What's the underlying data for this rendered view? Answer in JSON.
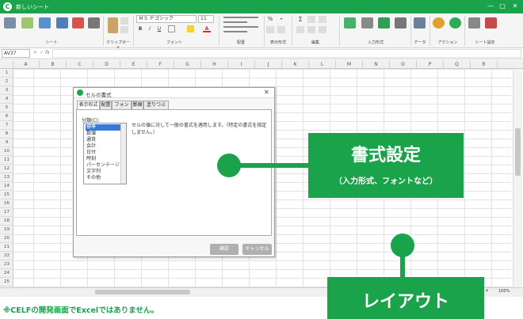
{
  "window": {
    "title": "新しいシート",
    "minimize": "—",
    "maximize": "□",
    "close": "✕"
  },
  "ribbon": {
    "font_name": "ＭＳ Ｐゴシック",
    "font_size": "11",
    "groups": {
      "sheet": "シート",
      "clipboard": "クリップボード",
      "font": "フォント",
      "alignment": "配置",
      "number_format": "表示形式",
      "edit": "編集",
      "input_format": "入力形式",
      "data": "データ",
      "action": "アクション",
      "sheet_settings": "シート設定"
    },
    "percent": "%",
    "comma": "•",
    "sigma": "Σ",
    "bold": "B",
    "italic": "I",
    "underline": "U",
    "font_color": "A"
  },
  "formula_bar": {
    "name_box": "AV37",
    "fx": "fx",
    "cancel": "✕",
    "confirm": "✓"
  },
  "grid": {
    "columns": [
      "A",
      "B",
      "C",
      "D",
      "E",
      "F",
      "G",
      "H",
      "I",
      "J",
      "K",
      "L",
      "M",
      "N",
      "O",
      "P",
      "Q",
      "R"
    ],
    "rows": [
      "1",
      "2",
      "3",
      "4",
      "5",
      "6",
      "7",
      "8",
      "9",
      "10",
      "11",
      "12",
      "13",
      "14",
      "15",
      "16",
      "17",
      "18",
      "19",
      "20",
      "21",
      "22",
      "23",
      "24",
      "25"
    ]
  },
  "bottom": {
    "zoom": "100%",
    "minus": "−",
    "plus": "+"
  },
  "dialog": {
    "title": "セルの書式",
    "close": "✕",
    "tabs": [
      "表示形式",
      "配置",
      "フォント",
      "罫線",
      "塗りつぶし"
    ],
    "category_label": "分類(C):",
    "categories": [
      "標準",
      "数値",
      "通貨",
      "会計",
      "日付",
      "時刻",
      "パーセンテージ",
      "文字列",
      "その他"
    ],
    "description": "セルの値に対して一般の書式を適用します。（特定の書式を指定しません。）",
    "ok": "確認",
    "cancel": "キャンセル"
  },
  "callouts": {
    "settings_title": "書式設定",
    "settings_sub": "（入力形式、フォントなど）",
    "layout_title": "レイアウト"
  },
  "footnote": "※CELFの開発画面でExcelではありません。",
  "colors": {
    "brand_green": "#1aa34a",
    "selection_blue": "#3a78d8"
  }
}
